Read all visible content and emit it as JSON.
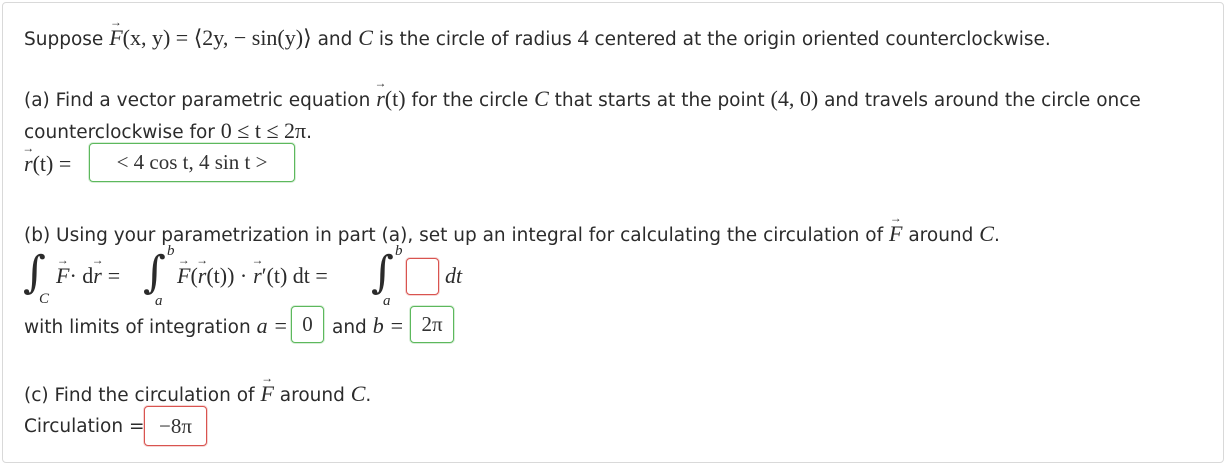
{
  "intro": {
    "prefix": "Suppose",
    "field_def": "(x, y) = ⟨2y, − sin(y)⟩",
    "middle": "and",
    "curve": "C",
    "suffix": "is the circle of radius",
    "radius": "4",
    "suffix2": "centered at the origin oriented counterclockwise."
  },
  "part_a": {
    "text1": "(a) Find a vector parametric equation",
    "r_of_t": "(t)",
    "text2": "for the circle",
    "curve": "C",
    "text3": "that starts at the point",
    "point": "(4, 0)",
    "text4": "and travels around the circle once",
    "line2_text": "counterclockwise for",
    "range": "0 ≤ t ≤ 2π",
    "period": ".",
    "answer_label": "(t) =",
    "answer_value": "< 4 cos t, 4 sin t >"
  },
  "part_b": {
    "text1": "(b) Using your parametrization in part (a), set up an integral for calculating the circulation of",
    "text2": "around",
    "curve": "C",
    "period": ".",
    "integrand_left": "· d",
    "eq": "=",
    "integrand_mid": "(",
    "integrand_mid2": "(t)) ·",
    "integrand_mid3": "′(t) dt =",
    "dt": "dt",
    "sub_C": "C",
    "lim_a": "a",
    "lim_b": "b",
    "integrand_value": "",
    "limits_text": "with limits of integration",
    "a_label": "a =",
    "a_value": "0",
    "and_text": "and",
    "b_label": "b =",
    "b_value": "2π"
  },
  "part_c": {
    "text1": "(c) Find the circulation of",
    "text2": "around",
    "curve": "C",
    "period": ".",
    "label": "Circulation =",
    "value": "−8π"
  },
  "colors": {
    "correct": "#5cb85c",
    "incorrect": "#d9534f",
    "text": "#2b2b2b"
  }
}
